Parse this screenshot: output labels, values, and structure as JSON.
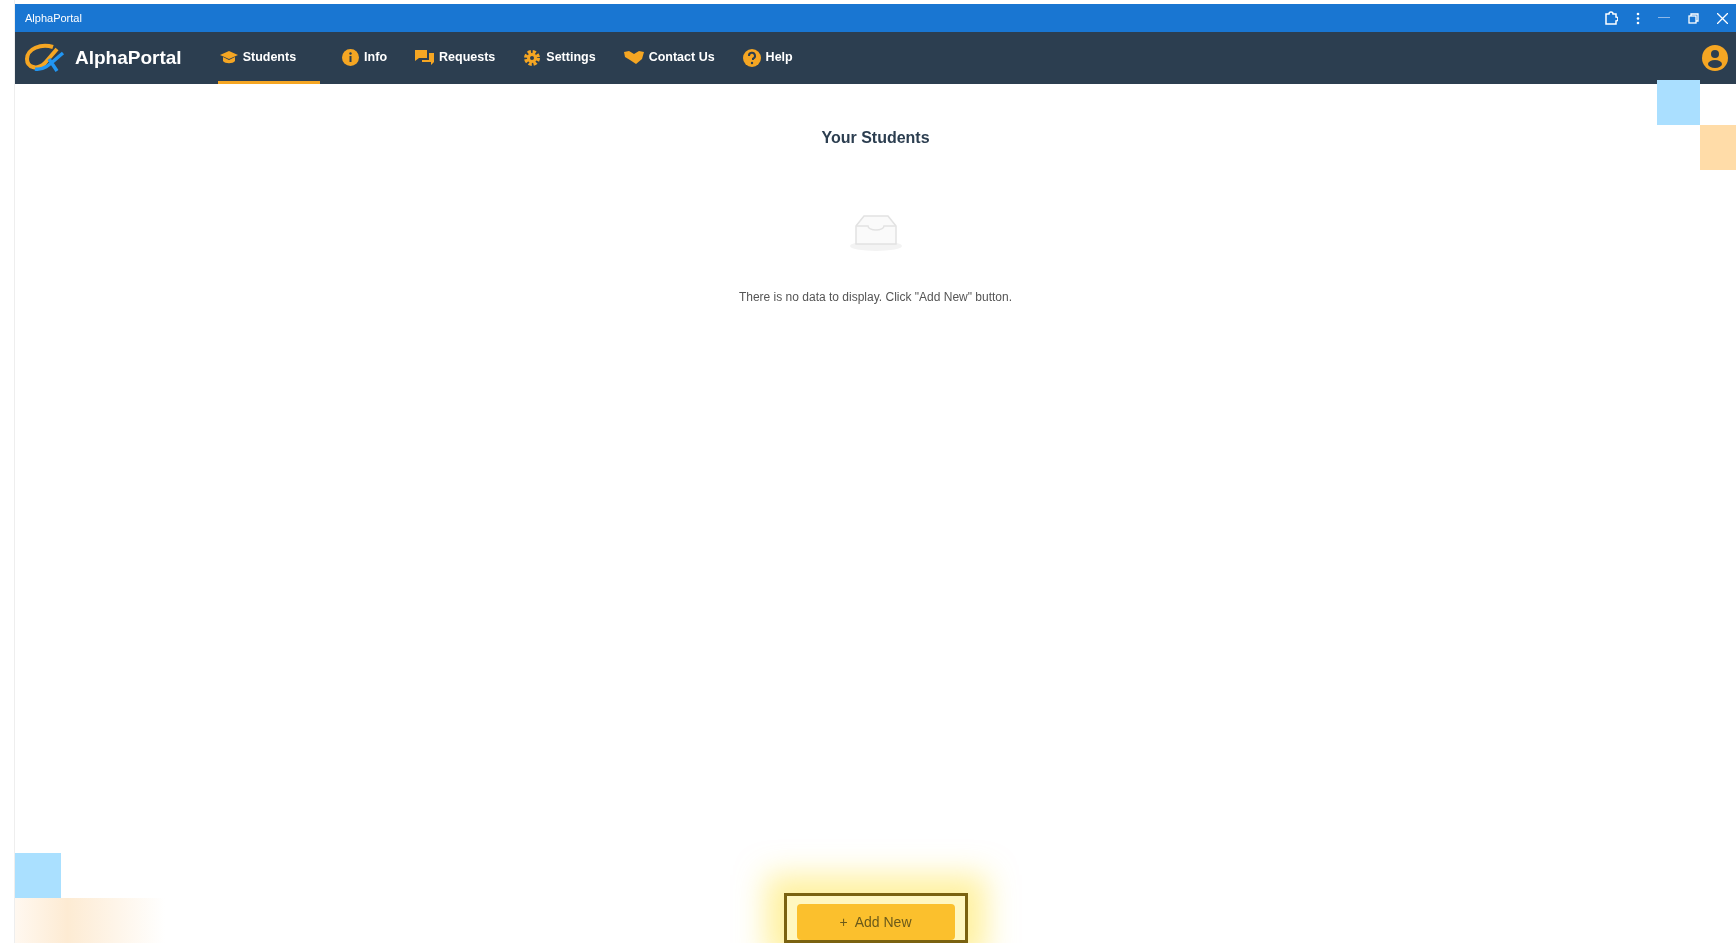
{
  "window": {
    "title": "AlphaPortal"
  },
  "app": {
    "name": "AlphaPortal"
  },
  "nav": [
    {
      "label": "Students",
      "selected": true
    },
    {
      "label": "Info",
      "selected": false
    },
    {
      "label": "Requests",
      "selected": false
    },
    {
      "label": "Settings",
      "selected": false
    },
    {
      "label": "Contact Us",
      "selected": false
    },
    {
      "label": "Help",
      "selected": false
    }
  ],
  "page": {
    "title": "Your Students",
    "empty_message": "There is no data to display. Click \"Add New\" button."
  },
  "add_button": {
    "icon": "+",
    "label": "Add New"
  }
}
